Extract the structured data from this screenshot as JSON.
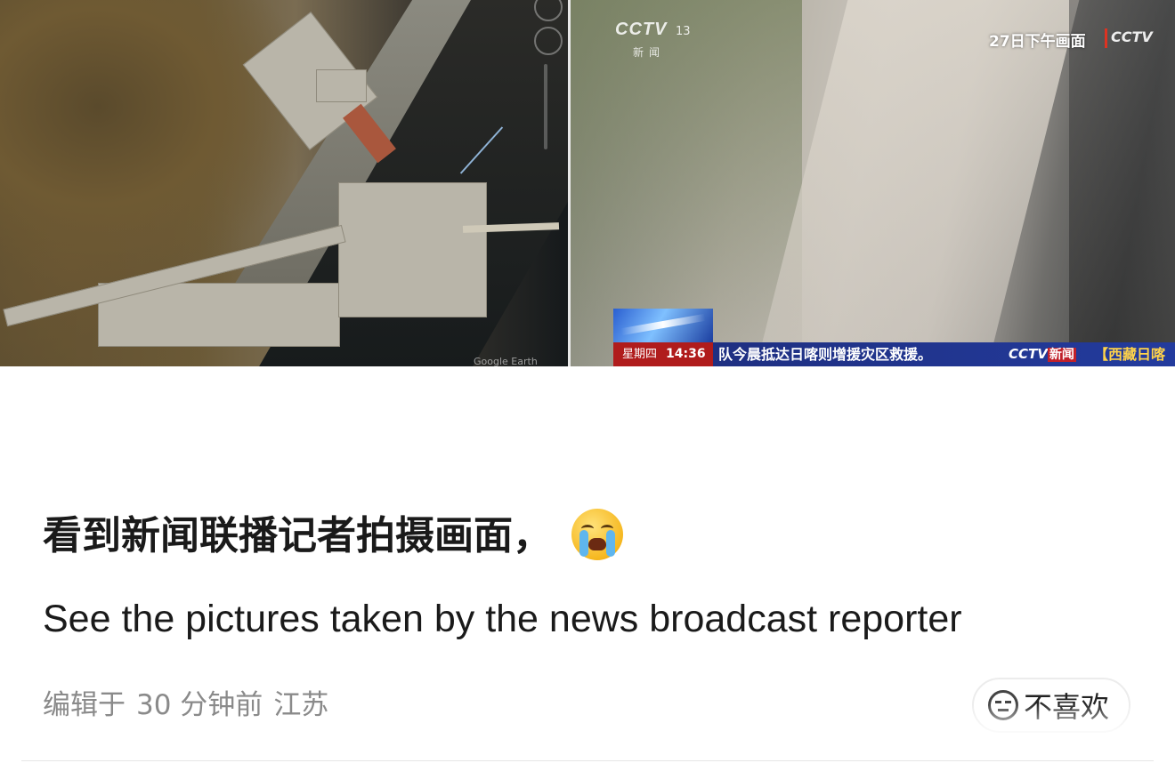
{
  "media": {
    "left_image": {
      "watermark": "Google Earth"
    },
    "right_image": {
      "channel_logo": "CCTV",
      "channel_number": "13",
      "channel_sub": "新闻",
      "timestamp_tag": "27日下午画面",
      "timestamp_logo": "CCTV",
      "ticker": {
        "day": "星期四",
        "time": "14:36",
        "text": "队今晨抵达日喀则增援灾区救援。",
        "logo": "CCTV",
        "logo_suffix": "新闻",
        "region": "【西藏日喀"
      }
    }
  },
  "post": {
    "title": "看到新闻联播记者拍摄画面，",
    "emoji": "loudly-crying-face",
    "subtitle": "See the pictures taken by the news broadcast reporter",
    "meta": {
      "edited_label": "编辑于",
      "time_ago": "30 分钟前",
      "location": "江苏"
    },
    "dislike_label": "不喜欢"
  },
  "colors": {
    "text_primary": "#1a1a1a",
    "text_secondary": "#8a8a8a",
    "ticker_blue": "#233b9d",
    "ticker_red": "#b01c1c"
  }
}
